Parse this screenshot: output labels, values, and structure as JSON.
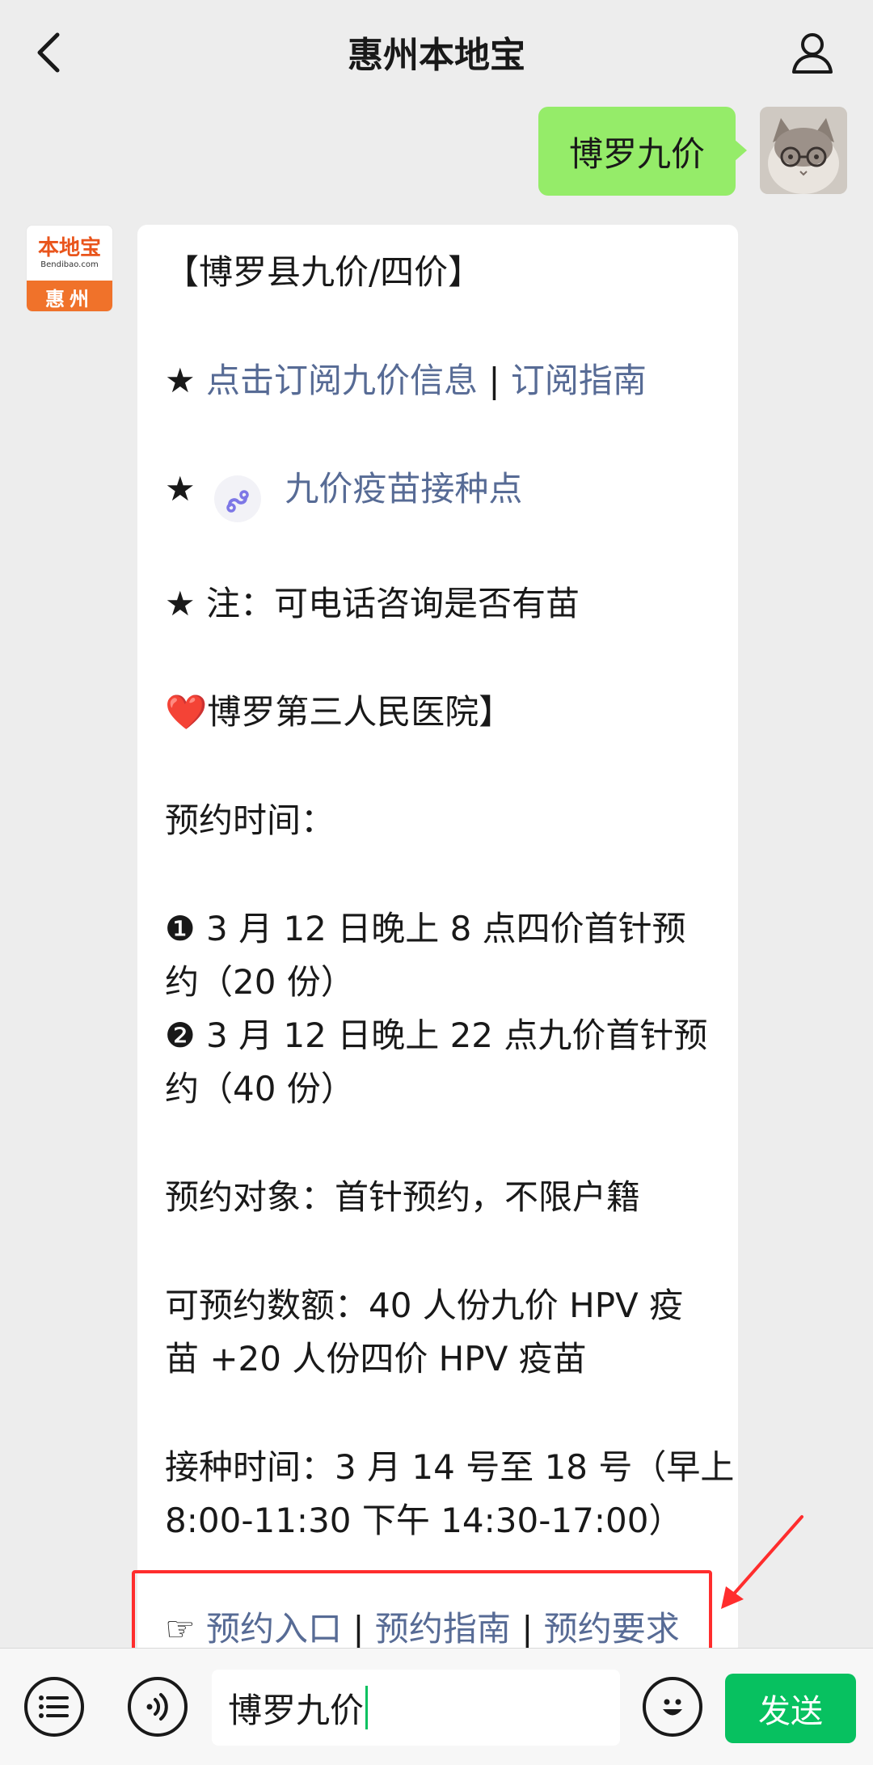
{
  "header": {
    "title": "惠州本地宝",
    "back_icon": "chevron-left-icon",
    "profile_icon": "person-icon"
  },
  "user_message": {
    "text": "博罗九价"
  },
  "bot_avatar": {
    "brand": "本地宝",
    "url": "Bendibao.com",
    "city": "惠州"
  },
  "bot_message": {
    "title": "【博罗县九价/四价】",
    "star": "★",
    "subscribe_link": "点击订阅九价信息",
    "separator": "|",
    "guide_link": "订阅指南",
    "mini_program_link": "九价疫苗接种点",
    "note": "注：可电话咨询是否有苗",
    "heart": "❤️",
    "hospital": "博罗第三人民医院】",
    "booking_time_label": "预约时间：",
    "item1_marker": "❶",
    "item1_line1": "3 月 12 日晚上 8 点四价首针预",
    "item1_line2": "约（20 份）",
    "item2_marker": "❷",
    "item2_line1": "3 月 12 日晚上 22 点九价首针预",
    "item2_line2": "约（40 份）",
    "target": "预约对象：首针预约，不限户籍",
    "quota_line1": "可预约数额：40 人份九价 HPV 疫",
    "quota_line2": "苗 +20 人份四价 HPV 疫苗",
    "vaccination_line1": "接种时间：3 月 14 号至 18 号（早上",
    "vaccination_line2": "8:00-11:30 下午 14:30-17:00）",
    "pointer": "☞",
    "booking_entry_link": "预约入口",
    "booking_guide_link": "预约指南",
    "booking_req_link": "预约要求"
  },
  "input_bar": {
    "menu_icon": "list-icon",
    "voice_icon": "voice-icon",
    "input_value": "博罗九价",
    "emoji_icon": "smiley-icon",
    "send_label": "发送"
  },
  "colors": {
    "background": "#ededed",
    "user_bubble": "#95ec69",
    "link": "#576b95",
    "send_button": "#07c160",
    "highlight": "#ff2d2d",
    "avatar_brand": "#f0722a"
  }
}
